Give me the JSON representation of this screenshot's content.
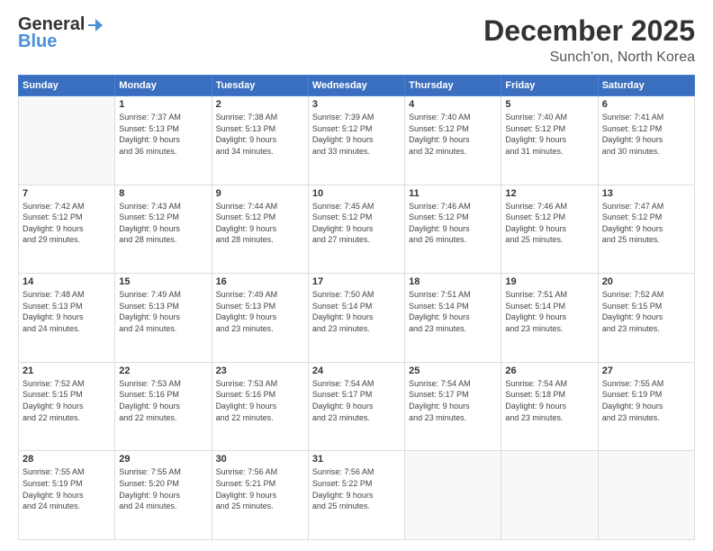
{
  "header": {
    "logo_line1": "General",
    "logo_line2": "Blue",
    "month_title": "December 2025",
    "location": "Sunch'on, North Korea"
  },
  "weekdays": [
    "Sunday",
    "Monday",
    "Tuesday",
    "Wednesday",
    "Thursday",
    "Friday",
    "Saturday"
  ],
  "weeks": [
    [
      {
        "day": "",
        "info": ""
      },
      {
        "day": "1",
        "info": "Sunrise: 7:37 AM\nSunset: 5:13 PM\nDaylight: 9 hours\nand 36 minutes."
      },
      {
        "day": "2",
        "info": "Sunrise: 7:38 AM\nSunset: 5:13 PM\nDaylight: 9 hours\nand 34 minutes."
      },
      {
        "day": "3",
        "info": "Sunrise: 7:39 AM\nSunset: 5:12 PM\nDaylight: 9 hours\nand 33 minutes."
      },
      {
        "day": "4",
        "info": "Sunrise: 7:40 AM\nSunset: 5:12 PM\nDaylight: 9 hours\nand 32 minutes."
      },
      {
        "day": "5",
        "info": "Sunrise: 7:40 AM\nSunset: 5:12 PM\nDaylight: 9 hours\nand 31 minutes."
      },
      {
        "day": "6",
        "info": "Sunrise: 7:41 AM\nSunset: 5:12 PM\nDaylight: 9 hours\nand 30 minutes."
      }
    ],
    [
      {
        "day": "7",
        "info": "Sunrise: 7:42 AM\nSunset: 5:12 PM\nDaylight: 9 hours\nand 29 minutes."
      },
      {
        "day": "8",
        "info": "Sunrise: 7:43 AM\nSunset: 5:12 PM\nDaylight: 9 hours\nand 28 minutes."
      },
      {
        "day": "9",
        "info": "Sunrise: 7:44 AM\nSunset: 5:12 PM\nDaylight: 9 hours\nand 28 minutes."
      },
      {
        "day": "10",
        "info": "Sunrise: 7:45 AM\nSunset: 5:12 PM\nDaylight: 9 hours\nand 27 minutes."
      },
      {
        "day": "11",
        "info": "Sunrise: 7:46 AM\nSunset: 5:12 PM\nDaylight: 9 hours\nand 26 minutes."
      },
      {
        "day": "12",
        "info": "Sunrise: 7:46 AM\nSunset: 5:12 PM\nDaylight: 9 hours\nand 25 minutes."
      },
      {
        "day": "13",
        "info": "Sunrise: 7:47 AM\nSunset: 5:12 PM\nDaylight: 9 hours\nand 25 minutes."
      }
    ],
    [
      {
        "day": "14",
        "info": "Sunrise: 7:48 AM\nSunset: 5:13 PM\nDaylight: 9 hours\nand 24 minutes."
      },
      {
        "day": "15",
        "info": "Sunrise: 7:49 AM\nSunset: 5:13 PM\nDaylight: 9 hours\nand 24 minutes."
      },
      {
        "day": "16",
        "info": "Sunrise: 7:49 AM\nSunset: 5:13 PM\nDaylight: 9 hours\nand 23 minutes."
      },
      {
        "day": "17",
        "info": "Sunrise: 7:50 AM\nSunset: 5:14 PM\nDaylight: 9 hours\nand 23 minutes."
      },
      {
        "day": "18",
        "info": "Sunrise: 7:51 AM\nSunset: 5:14 PM\nDaylight: 9 hours\nand 23 minutes."
      },
      {
        "day": "19",
        "info": "Sunrise: 7:51 AM\nSunset: 5:14 PM\nDaylight: 9 hours\nand 23 minutes."
      },
      {
        "day": "20",
        "info": "Sunrise: 7:52 AM\nSunset: 5:15 PM\nDaylight: 9 hours\nand 23 minutes."
      }
    ],
    [
      {
        "day": "21",
        "info": "Sunrise: 7:52 AM\nSunset: 5:15 PM\nDaylight: 9 hours\nand 22 minutes."
      },
      {
        "day": "22",
        "info": "Sunrise: 7:53 AM\nSunset: 5:16 PM\nDaylight: 9 hours\nand 22 minutes."
      },
      {
        "day": "23",
        "info": "Sunrise: 7:53 AM\nSunset: 5:16 PM\nDaylight: 9 hours\nand 22 minutes."
      },
      {
        "day": "24",
        "info": "Sunrise: 7:54 AM\nSunset: 5:17 PM\nDaylight: 9 hours\nand 23 minutes."
      },
      {
        "day": "25",
        "info": "Sunrise: 7:54 AM\nSunset: 5:17 PM\nDaylight: 9 hours\nand 23 minutes."
      },
      {
        "day": "26",
        "info": "Sunrise: 7:54 AM\nSunset: 5:18 PM\nDaylight: 9 hours\nand 23 minutes."
      },
      {
        "day": "27",
        "info": "Sunrise: 7:55 AM\nSunset: 5:19 PM\nDaylight: 9 hours\nand 23 minutes."
      }
    ],
    [
      {
        "day": "28",
        "info": "Sunrise: 7:55 AM\nSunset: 5:19 PM\nDaylight: 9 hours\nand 24 minutes."
      },
      {
        "day": "29",
        "info": "Sunrise: 7:55 AM\nSunset: 5:20 PM\nDaylight: 9 hours\nand 24 minutes."
      },
      {
        "day": "30",
        "info": "Sunrise: 7:56 AM\nSunset: 5:21 PM\nDaylight: 9 hours\nand 25 minutes."
      },
      {
        "day": "31",
        "info": "Sunrise: 7:56 AM\nSunset: 5:22 PM\nDaylight: 9 hours\nand 25 minutes."
      },
      {
        "day": "",
        "info": ""
      },
      {
        "day": "",
        "info": ""
      },
      {
        "day": "",
        "info": ""
      }
    ]
  ]
}
